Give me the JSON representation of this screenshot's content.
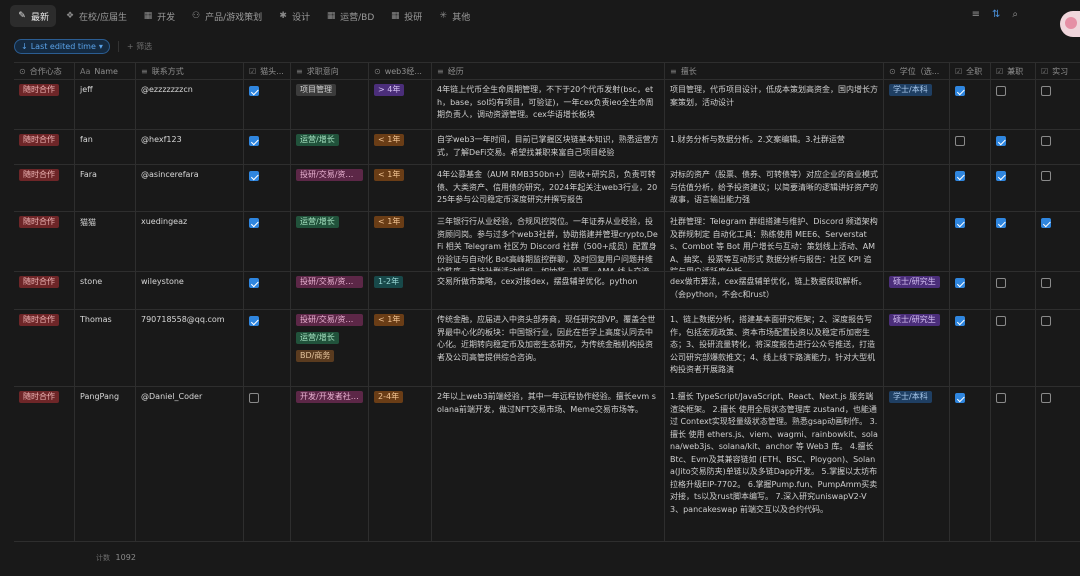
{
  "tabs": [
    {
      "label": "最新",
      "icon": "pin-icon",
      "glyph": "✎",
      "active": true
    },
    {
      "label": "在校/应届生",
      "icon": "grid-icon",
      "glyph": "❖",
      "active": false
    },
    {
      "label": "开发",
      "icon": "table-icon",
      "glyph": "▦",
      "active": false
    },
    {
      "label": "产品/游戏策划",
      "icon": "gamepad-icon",
      "glyph": "⚇",
      "active": false
    },
    {
      "label": "设计",
      "icon": "settings-icon",
      "glyph": "✱",
      "active": false
    },
    {
      "label": "运营/BD",
      "icon": "table-icon",
      "glyph": "▦",
      "active": false
    },
    {
      "label": "投研",
      "icon": "table-icon",
      "glyph": "▦",
      "active": false
    },
    {
      "label": "其他",
      "icon": "asterisk-icon",
      "glyph": "✳",
      "active": false
    }
  ],
  "toolbar": {
    "filter_icon": "≡",
    "sort_icon": "⇅",
    "search_icon": "⌕"
  },
  "filters": {
    "sort_chip": "Last edited time",
    "sort_arrow": "↓",
    "chevron": "▾",
    "add_filter": "+ 筛选"
  },
  "columns": [
    {
      "label": "合作心态",
      "icon": "⊙"
    },
    {
      "label": "Name",
      "icon": "Aa"
    },
    {
      "label": "联系方式",
      "icon": "≡"
    },
    {
      "label": "猫头...",
      "icon": "☑"
    },
    {
      "label": "求职意向",
      "icon": "≡"
    },
    {
      "label": "web3经...",
      "icon": "⊙"
    },
    {
      "label": "经历",
      "icon": "≡"
    },
    {
      "label": "擅长",
      "icon": "≡"
    },
    {
      "label": "学位（选...",
      "icon": "⊙"
    },
    {
      "label": "全职",
      "icon": "☑"
    },
    {
      "label": "兼职",
      "icon": "☑"
    },
    {
      "label": "实习",
      "icon": "☑"
    }
  ],
  "rows": [
    {
      "status": "随时合作",
      "name": "jeff",
      "contact": "@ezzzzzzzcn",
      "cat": true,
      "intents": [
        {
          "label": "项目管理",
          "color": "gray"
        }
      ],
      "years": {
        "label": "> 4年",
        "color": "purple"
      },
      "experience": "4年链上代币全生命周期管理，不下于20个代币发射(bsc，eth，base，sol均有项目，可验证)，一年cex负责ieo全生命周期负责人，调动资源管理。cex华语增长板块",
      "skills": "项目管理，代币项目设计，低成本策划高资金，国内增长方案策划，活动设计",
      "degree": {
        "label": "学士/本科",
        "color": "blue"
      },
      "fulltime": true,
      "parttime": false,
      "intern": false
    },
    {
      "status": "随时合作",
      "name": "fan",
      "contact": "@hexf123",
      "cat": true,
      "intents": [
        {
          "label": "运营/增长",
          "color": "green"
        }
      ],
      "years": {
        "label": "< 1年",
        "color": "orange"
      },
      "experience": "自学web3一年时间，目前已掌握区块链基本知识，熟悉运营方式，了解DeFi交易。希望找兼职来富自己项目经验",
      "skills": "1.财务分析与数据分析。2.文案编辑。3.社群运营",
      "degree": null,
      "fulltime": false,
      "parttime": true,
      "intern": false
    },
    {
      "status": "随时合作",
      "name": "Fara",
      "contact": "@asincerefara",
      "cat": true,
      "intents": [
        {
          "label": "投研/交易/资产管理",
          "color": "pink"
        }
      ],
      "years": {
        "label": "< 1年",
        "color": "orange"
      },
      "experience": "4年公募基金（AUM RMB350bn+）固收+研究员，负责可转债、大类资产、信用债的研究，2024年起关注web3行业，2025年参与公司稳定币深度研究并撰写报告",
      "skills": "对标的资产（股票、债券、可转债等）对应企业的商业模式与估值分析，给予投资建议；以简要清晰的逻辑讲好资产的故事，语言输出能力强",
      "degree": null,
      "fulltime": true,
      "parttime": true,
      "intern": false
    },
    {
      "status": "随时合作",
      "name": "猫猫",
      "contact": "xuedingeaz",
      "cat": true,
      "intents": [
        {
          "label": "运营/增长",
          "color": "green"
        }
      ],
      "years": {
        "label": "< 1年",
        "color": "orange"
      },
      "experience": "三年银行行从业经验，合规风控岗位。一年证券从业经验，投资顾问岗。参与过多个web3社群，协助搭建并管理crypto,DeFi 相关 Telegram 社区为 Discord 社群（500+成员）配置身份验证与自动化 Bot高峰期监控群聊，及时回复用户问题并维护秩序。支持社群活动组织，如抽奖、投票、AMA 线上交流等。",
      "skills": "社群管理：Telegram 群组搭建与维护、Discord 频道架构及群规制定 自动化工具：熟练使用 MEE6、Serverstats、Combot 等 Bot 用户增长与互动：策划线上活动、AMA、抽奖、投票等互动形式 数据分析与报告：社区 KPI 追踪与用户活跃度分析",
      "degree": null,
      "fulltime": true,
      "parttime": true,
      "intern": true
    },
    {
      "status": "随时合作",
      "name": "stone",
      "contact": "wileystone",
      "cat": true,
      "intents": [
        {
          "label": "投研/交易/资产管理",
          "color": "pink"
        }
      ],
      "years": {
        "label": "1-2年",
        "color": "teal"
      },
      "experience": "交易所做市策略，cex对接dex，摆盘辅单优化。python",
      "skills": "dex做市算法，cex摆盘辅单优化，链上数据获取解析。（会python，不会c和rust）",
      "degree": {
        "label": "硕士/研究生",
        "color": "purple"
      },
      "fulltime": true,
      "parttime": false,
      "intern": false
    },
    {
      "status": "随时合作",
      "name": "Thomas",
      "contact": "790718558@qq.com",
      "cat": true,
      "intents": [
        {
          "label": "投研/交易/资产管理",
          "color": "pink"
        },
        {
          "label": "运营/增长",
          "color": "green"
        },
        {
          "label": "BD/商务",
          "color": "brown"
        }
      ],
      "years": {
        "label": "< 1年",
        "color": "orange"
      },
      "experience": "传统金融，应届进入中资头部券商，现任研究部VP。覆盖全世界最中心化的板块：中国银行业，因此在哲学上高度认同去中心化。近期转向稳定币及加密生态研究，为传统金融机构投资者及公司高管提供综合咨询。",
      "skills": "1、链上数据分析，搭建基本面研究框架；2、深度报告写作，包括宏观政策、资本市场配置投资以及稳定币加密生态；3、投研流量转化，将深度报告进行公众号推送，打造公司研究部爆款推文；4、线上线下路演能力，针对大型机构投资者开展路演",
      "degree": {
        "label": "硕士/研究生",
        "color": "purple"
      },
      "fulltime": true,
      "parttime": false,
      "intern": false
    },
    {
      "status": "随时合作",
      "name": "PangPang",
      "contact": "@Daniel_Coder",
      "cat": false,
      "intents": [
        {
          "label": "开发/开发者社区运营",
          "color": "pink"
        }
      ],
      "years": {
        "label": "2-4年",
        "color": "orange"
      },
      "experience": "2年以上web3前端经验，其中一年远程协作经验。擅长evm solana前端开发，做过NFT交易市场、Meme交易市场等。",
      "skills": "1.擅长 TypeScript/JavaScript、React、Next.js 服务端渲染框架。 2.擅长 使用全局状态管理库 zustand，也能通过 Context实现轻量级状态管理。熟悉gsap动画制作。 3.擅长 使用 ethers.js、viem、wagmi、rainbowkit、solana/web3js、solana/kit、anchor 等 Web3 库。 4.擅长 Btc、Evm及其兼容链如 (ETH、BSC、Ploygon)、Solana(Jito交易防夹)单链以及多链Dapp开发。 5.掌握以太坊布拉格升级EIP-7702。 6.掌握Pump.fun、PumpAmm买卖对接，ts以及rust脚本编写。 7.深入研究uniswapV2-V3、pancakeswap 前端交互以及合约代码。",
      "degree": {
        "label": "学士/本科",
        "color": "blue"
      },
      "fulltime": true,
      "parttime": false,
      "intern": false
    }
  ],
  "footer": {
    "label": "计数",
    "count": "1092"
  }
}
